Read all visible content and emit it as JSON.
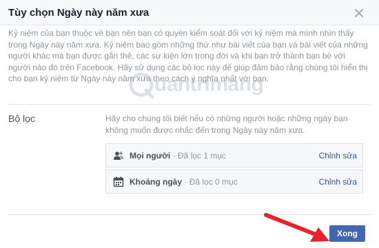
{
  "dialog": {
    "title": "Tùy chọn Ngày này năm xưa",
    "intro": "Kỷ niệm của bạn thuộc về bạn nên bạn có quyền kiểm soát đối với kỷ niệm mà mình nhìn thấy trong Ngày này năm xưa. Kỷ niệm bao gồm những thứ như bài viết của bạn và bài viết của những người khác mà bạn được gắn thẻ, các sự kiện lớn trong đời và khi bạn trở thành bạn bè với người nào đó trên Facebook. Hãy sử dụng các bộ lọc này để giúp đảm bảo rằng chúng tôi hiển thị cho bạn kỷ niệm từ Ngày này năm xưa theo cách ý nghĩa nhất với bạn."
  },
  "filters": {
    "label": "Bộ lọc",
    "description": "Hãy cho chúng tôi biết nếu có những người hoặc những ngày bạn không muốn được nhắc đến trong Ngày này năm xưa.",
    "rows": [
      {
        "icon": "people-icon",
        "name": "Mọi người",
        "separator": " · ",
        "status": "Đã lọc 1 mục",
        "edit_label": "Chỉnh sửa"
      },
      {
        "icon": "calendar-icon",
        "name": "Khoảng ngày",
        "separator": " · ",
        "status": "Đã lọc 0 mục",
        "edit_label": "Chỉnh sửa"
      }
    ]
  },
  "footer": {
    "save_label": "Xong"
  },
  "watermark": {
    "text": "uantrimang"
  },
  "colors": {
    "header_bg": "#f6f7f9",
    "link": "#365899",
    "primary_button": "#4267b2",
    "annotation_arrow": "#e8212a"
  }
}
